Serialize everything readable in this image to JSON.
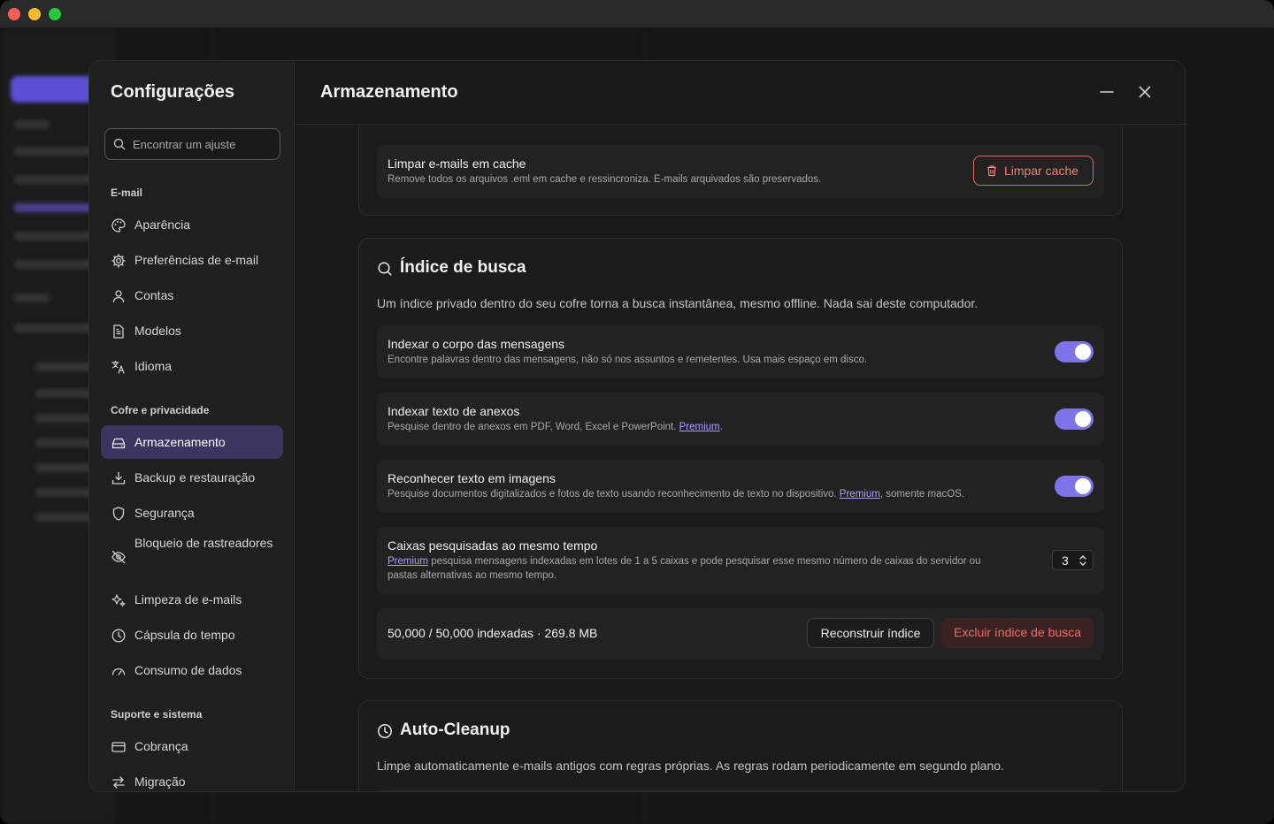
{
  "settings": {
    "title": "Configurações",
    "search_placeholder": "Encontrar um ajuste",
    "groups": [
      {
        "heading": "E-mail",
        "items": [
          "Aparência",
          "Preferências de e-mail",
          "Contas",
          "Modelos",
          "Idioma"
        ]
      },
      {
        "heading": "Cofre e privacidade",
        "items": [
          "Armazenamento",
          "Backup e restauração",
          "Segurança",
          "Bloqueio de rastreadores",
          "Limpeza de e-mails",
          "Cápsula do tempo",
          "Consumo de dados"
        ]
      },
      {
        "heading": "Suporte e sistema",
        "items": [
          "Cobrança",
          "Migração"
        ]
      }
    ],
    "active_item": "Armazenamento"
  },
  "page": {
    "title": "Armazenamento",
    "cache": {
      "title": "Limpar e-mails em cache",
      "desc": "Remove todos os arquivos .eml em cache e ressincroniza. E-mails arquivados são preservados.",
      "button": "Limpar cache"
    },
    "search_index": {
      "heading": "Índice de busca",
      "desc": "Um índice privado dentro do seu cofre torna a busca instantânea, mesmo offline. Nada sai deste computador.",
      "rows": [
        {
          "title": "Indexar o corpo das mensagens",
          "desc": "Encontre palavras dentro das mensagens, não só nos assuntos e remetentes. Usa mais espaço em disco.",
          "enabled": true
        },
        {
          "title": "Indexar texto de anexos",
          "desc_pre": "Pesquise dentro de anexos em PDF, Word, Excel e PowerPoint. ",
          "link": "Premium",
          "desc_post": ".",
          "enabled": true
        },
        {
          "title": "Reconhecer texto em imagens",
          "desc_pre": "Pesquise documentos digitalizados e fotos de texto usando reconhecimento de texto no dispositivo. ",
          "link": "Premium",
          "desc_post": ", somente macOS.",
          "enabled": true
        }
      ],
      "concurrent": {
        "title": "Caixas pesquisadas ao mesmo tempo",
        "link": "Premium",
        "desc_line1": " pesquisa mensagens indexadas em lotes de 1 a 5 caixas e pode pesquisar esse mesmo número de caixas do servidor ou",
        "desc_line2": "pastas alternativas ao mesmo tempo.",
        "value": "3"
      },
      "status": "50,000 / 50,000 indexadas · 269.8 MB",
      "rebuild_button": "Reconstruir índice",
      "delete_button": "Excluir índice de busca"
    },
    "auto_cleanup": {
      "heading": "Auto-Cleanup",
      "desc": "Limpe automaticamente e-mails antigos com regras próprias. As regras rodam periodicamente em segundo plano."
    }
  },
  "colors": {
    "accent": "#7e73e8",
    "danger": "#ec6f66",
    "active_nav": "#3a3461"
  }
}
